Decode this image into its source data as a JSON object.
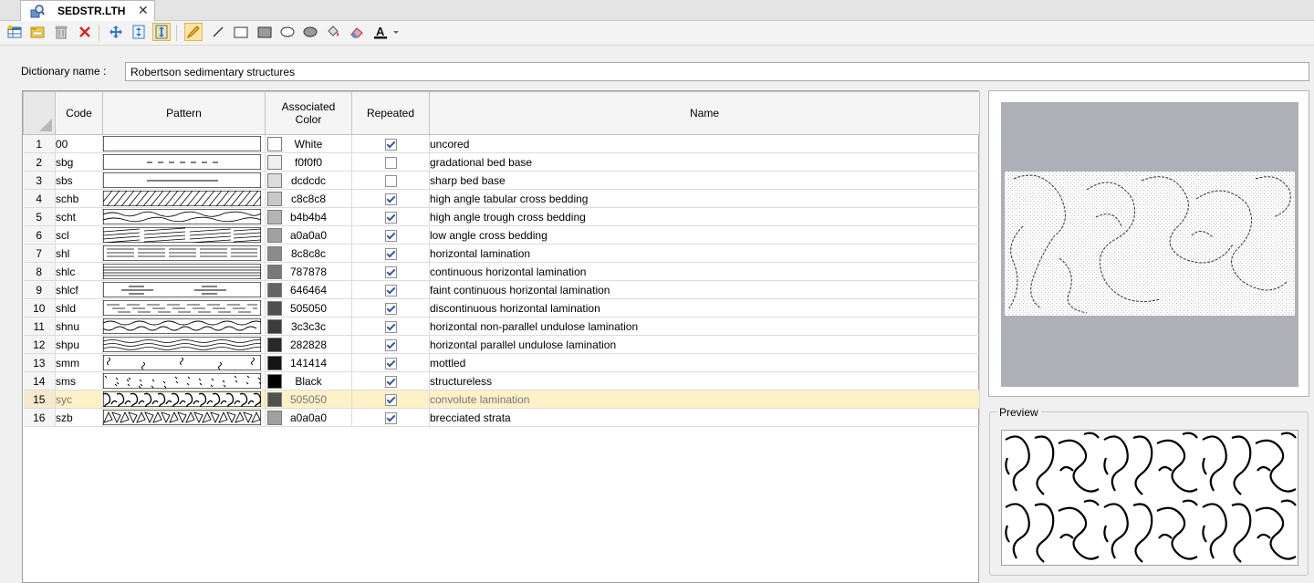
{
  "tab": {
    "title": "SEDSTR.LTH"
  },
  "dictionary": {
    "label": "Dictionary name :",
    "value": "Robertson sedimentary structures"
  },
  "columns": {
    "code": "Code",
    "pattern": "Pattern",
    "color_line1": "Associated",
    "color_line2": "Color",
    "repeated": "Repeated",
    "name": "Name"
  },
  "rows": [
    {
      "num": "1",
      "code": "00",
      "swatch": "#ffffff",
      "color": "White",
      "repeated": true,
      "name": "uncored"
    },
    {
      "num": "2",
      "code": "sbg",
      "swatch": "#f0f0f0",
      "color": "f0f0f0",
      "repeated": false,
      "name": "gradational bed base"
    },
    {
      "num": "3",
      "code": "sbs",
      "swatch": "#dcdcdc",
      "color": "dcdcdc",
      "repeated": false,
      "name": "sharp bed base"
    },
    {
      "num": "4",
      "code": "schb",
      "swatch": "#c8c8c8",
      "color": "c8c8c8",
      "repeated": true,
      "name": "high angle tabular cross bedding"
    },
    {
      "num": "5",
      "code": "scht",
      "swatch": "#b4b4b4",
      "color": "b4b4b4",
      "repeated": true,
      "name": "high angle trough cross bedding"
    },
    {
      "num": "6",
      "code": "scl",
      "swatch": "#a0a0a0",
      "color": "a0a0a0",
      "repeated": true,
      "name": "low angle cross bedding"
    },
    {
      "num": "7",
      "code": "shl",
      "swatch": "#8c8c8c",
      "color": "8c8c8c",
      "repeated": true,
      "name": "horizontal lamination"
    },
    {
      "num": "8",
      "code": "shlc",
      "swatch": "#787878",
      "color": "787878",
      "repeated": true,
      "name": "continuous horizontal lamination"
    },
    {
      "num": "9",
      "code": "shlcf",
      "swatch": "#646464",
      "color": "646464",
      "repeated": true,
      "name": "faint continuous horizontal lamination"
    },
    {
      "num": "10",
      "code": "shld",
      "swatch": "#505050",
      "color": "505050",
      "repeated": true,
      "name": "discontinuous horizontal lamination"
    },
    {
      "num": "11",
      "code": "shnu",
      "swatch": "#3c3c3c",
      "color": "3c3c3c",
      "repeated": true,
      "name": "horizontal non-parallel undulose lamination"
    },
    {
      "num": "12",
      "code": "shpu",
      "swatch": "#282828",
      "color": "282828",
      "repeated": true,
      "name": "horizontal parallel undulose lamination"
    },
    {
      "num": "13",
      "code": "smm",
      "swatch": "#141414",
      "color": "141414",
      "repeated": true,
      "name": "mottled"
    },
    {
      "num": "14",
      "code": "sms",
      "swatch": "#000000",
      "color": "Black",
      "repeated": true,
      "name": "structureless"
    },
    {
      "num": "15",
      "code": "syc",
      "swatch": "#505050",
      "color": "505050",
      "repeated": true,
      "name": "convolute lamination",
      "selected": true
    },
    {
      "num": "16",
      "code": "szb",
      "swatch": "#a0a0a0",
      "color": "a0a0a0",
      "repeated": true,
      "name": "brecciated strata"
    }
  ],
  "preview": {
    "label": "Preview"
  },
  "toolbar": {
    "icons": [
      "new-table-icon",
      "open-folder-icon",
      "trash-icon",
      "delete-x-icon",
      "move-icon",
      "fit-vertical-icon",
      "fit-both-icon",
      "pencil-icon",
      "line-icon",
      "rectangle-icon",
      "filled-rectangle-icon",
      "ellipse-icon",
      "filled-ellipse-icon",
      "fill-bucket-icon",
      "eraser-icon",
      "text-color-icon",
      "dropdown-arrow-icon"
    ]
  },
  "colors": {
    "selected_row": "#fdf1c8",
    "toolbar_active": "#fbe3a6",
    "preview_bg": "#aeb0b8"
  }
}
